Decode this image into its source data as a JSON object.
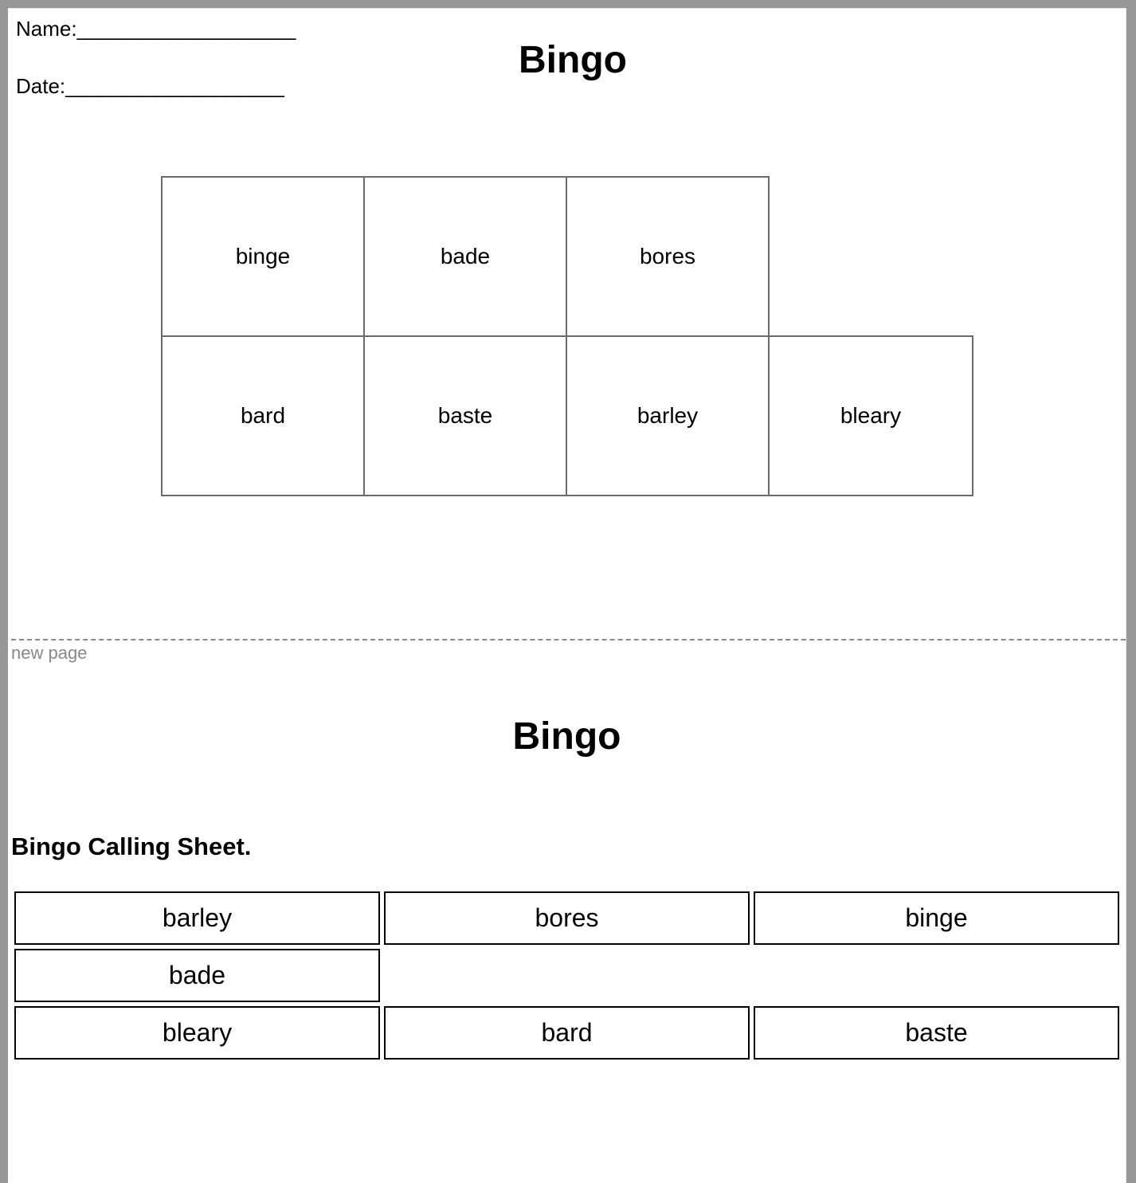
{
  "page1": {
    "name_field": "Name:___________________",
    "date_field": "Date:___________________",
    "title": "Bingo",
    "card_rows": [
      [
        "binge",
        "bade",
        "bores"
      ],
      [
        "bard",
        "baste",
        "barley",
        "bleary"
      ]
    ]
  },
  "page_break_label": "new page",
  "page2": {
    "title": "Bingo",
    "calling_heading": "Bingo Calling Sheet.",
    "calling_rows": [
      [
        "barley",
        "bores",
        "binge"
      ],
      [
        "bade"
      ],
      [
        "bleary",
        "bard",
        "baste"
      ]
    ]
  }
}
